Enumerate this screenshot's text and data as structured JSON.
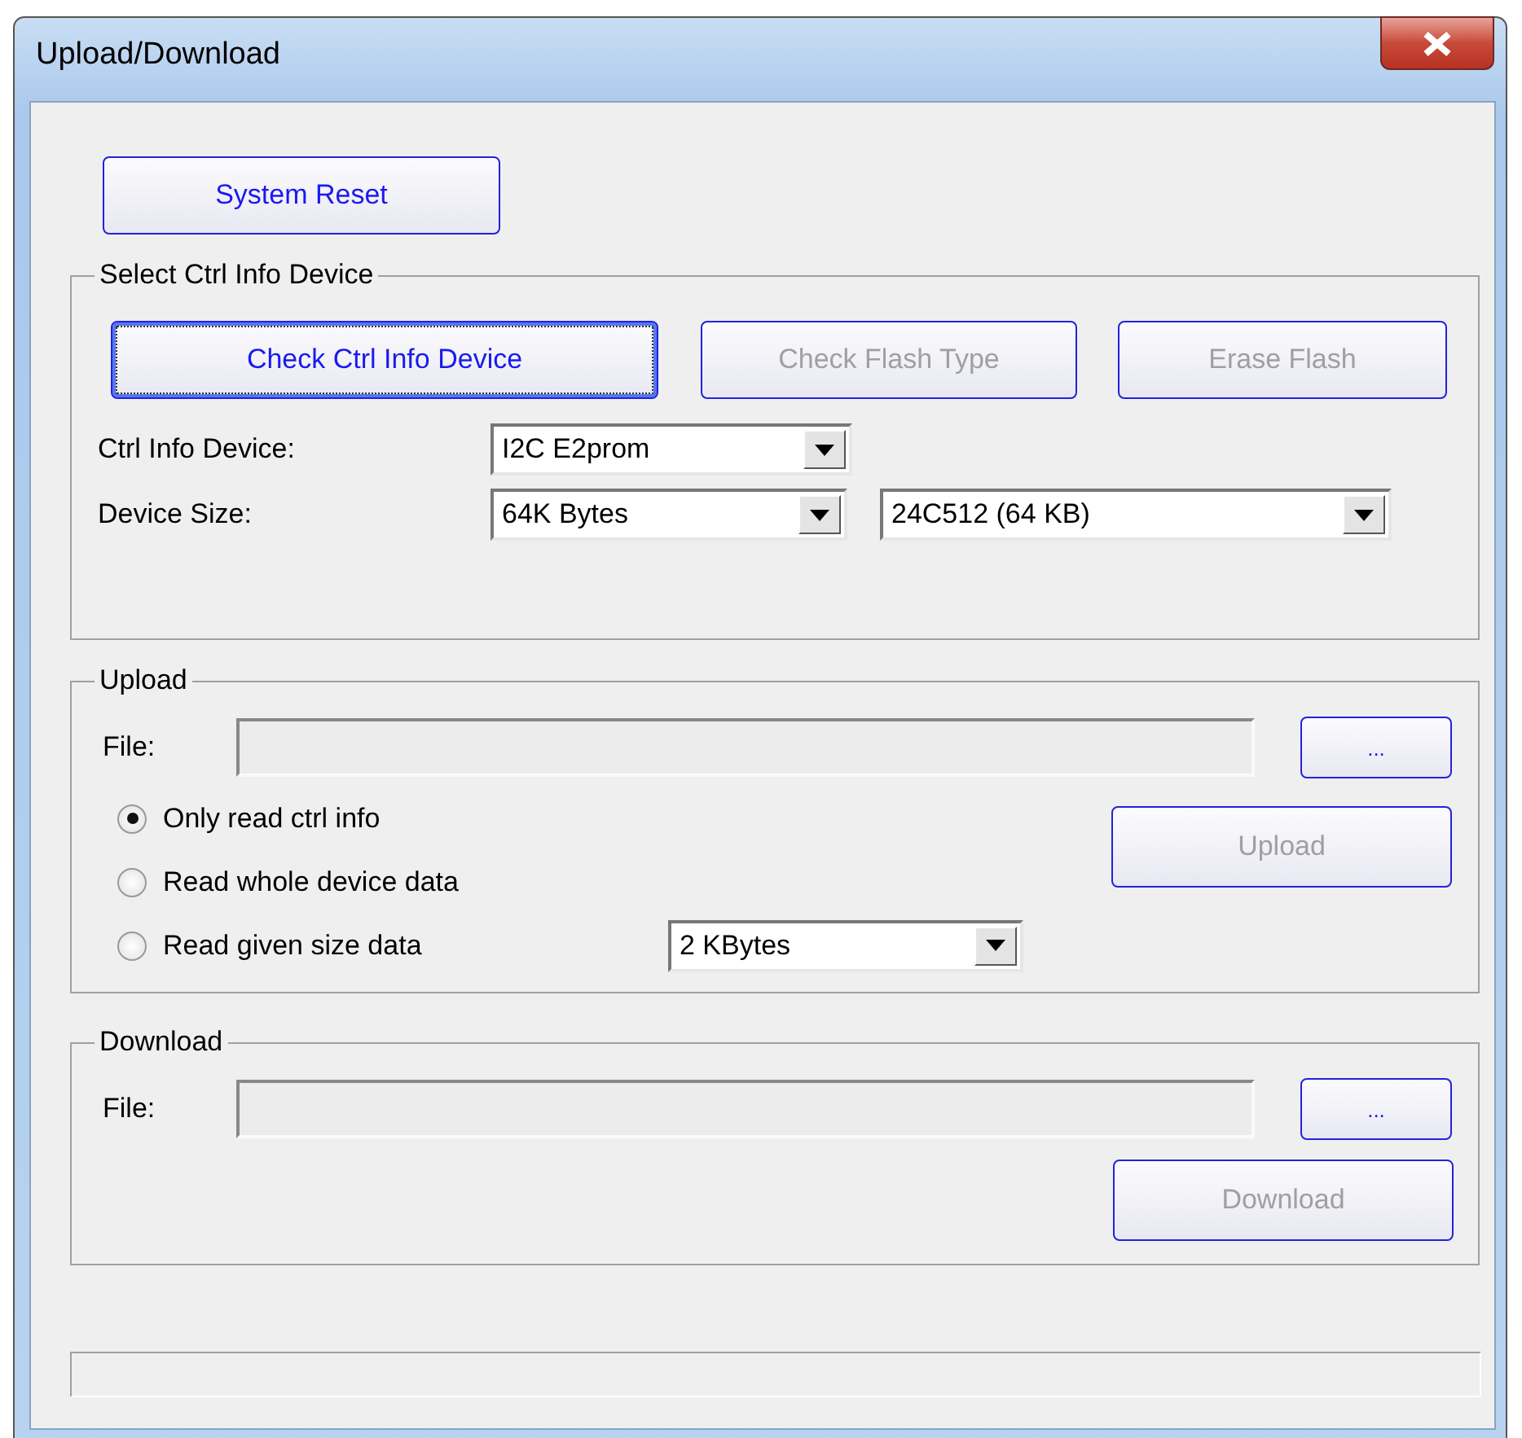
{
  "window": {
    "title": "Upload/Download"
  },
  "system_reset_button": {
    "label": "System Reset",
    "disabled": false
  },
  "select_ctrl_info_device": {
    "title": "Select Ctrl Info Device",
    "buttons": [
      {
        "label": "Check Ctrl Info Device",
        "disabled": false,
        "focused": true
      },
      {
        "label": "Check Flash Type",
        "disabled": true,
        "focused": false
      },
      {
        "label": "Erase Flash",
        "disabled": true,
        "focused": false
      }
    ],
    "ctrl_info_device": {
      "label": "Ctrl Info Device:",
      "value": "I2C E2prom"
    },
    "device_size": {
      "label": "Device Size:",
      "value": "64K  Bytes",
      "model_value": "24C512 (64 KB)"
    }
  },
  "upload": {
    "title": "Upload",
    "file_label": "File:",
    "file_field": {
      "disabled": true
    },
    "browse_button": {
      "label": "...",
      "disabled": false
    },
    "options": [
      {
        "label": "Only read ctrl info",
        "selected": true
      },
      {
        "label": "Read whole device data",
        "selected": false
      },
      {
        "label": "Read given size data",
        "selected": false
      }
    ],
    "size_value": "2 KBytes",
    "upload_button": {
      "label": "Upload",
      "disabled": true
    }
  },
  "download": {
    "title": "Download",
    "file_label": "File:",
    "file_field": {
      "disabled": true
    },
    "browse_button": {
      "label": "...",
      "disabled": false
    },
    "download_button": {
      "label": "Download",
      "disabled": true
    }
  }
}
